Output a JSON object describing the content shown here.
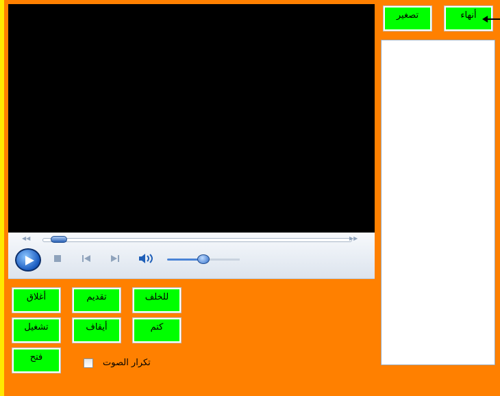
{
  "colors": {
    "background": "#FF8000",
    "left_edge": "#FFE800",
    "button": "#00FF00",
    "video": "#000000",
    "playlist": "#FFFFFF"
  },
  "top_bar": {
    "exit_label": "أنهاء",
    "minimize_label": "تصغير"
  },
  "player": {
    "icons": [
      "seek-back-icon",
      "seek-forward-icon",
      "play-icon",
      "stop-icon",
      "previous-icon",
      "next-icon",
      "volume-icon"
    ],
    "seek_position": 0.03,
    "volume_level": 0.5
  },
  "buttons": {
    "close_label": "أغلاق",
    "forward_label": "تقديم",
    "backward_label": "للخلف",
    "play_label": "تشغيل",
    "stop_label": "أيقاف",
    "mute_label": "كتم",
    "open_label": "فتح"
  },
  "repeat": {
    "label": "تكرار الصوت",
    "checked": false
  }
}
